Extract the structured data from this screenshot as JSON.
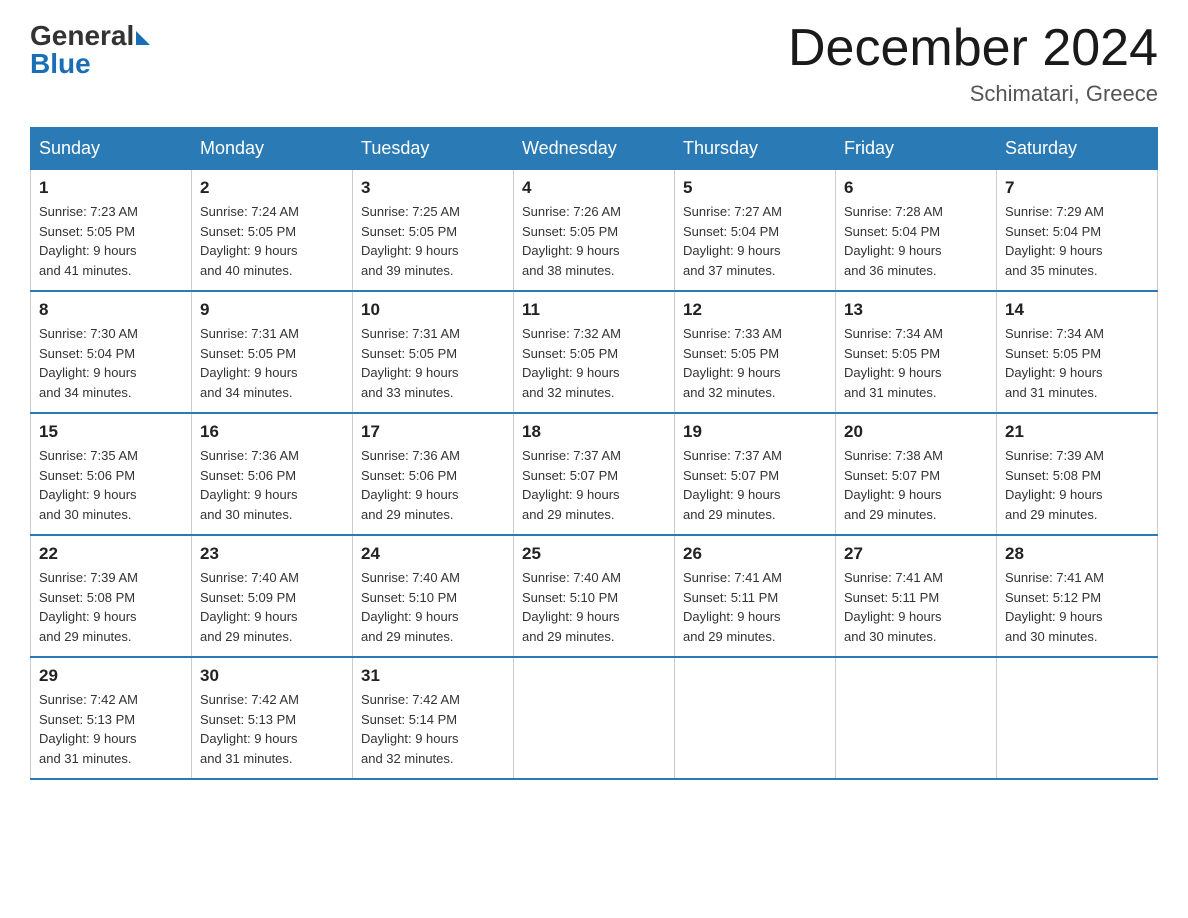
{
  "logo": {
    "general": "General",
    "blue": "Blue"
  },
  "title": "December 2024",
  "location": "Schimatari, Greece",
  "days_of_week": [
    "Sunday",
    "Monday",
    "Tuesday",
    "Wednesday",
    "Thursday",
    "Friday",
    "Saturday"
  ],
  "weeks": [
    [
      {
        "day": "1",
        "sunrise": "7:23 AM",
        "sunset": "5:05 PM",
        "daylight": "9 hours and 41 minutes."
      },
      {
        "day": "2",
        "sunrise": "7:24 AM",
        "sunset": "5:05 PM",
        "daylight": "9 hours and 40 minutes."
      },
      {
        "day": "3",
        "sunrise": "7:25 AM",
        "sunset": "5:05 PM",
        "daylight": "9 hours and 39 minutes."
      },
      {
        "day": "4",
        "sunrise": "7:26 AM",
        "sunset": "5:05 PM",
        "daylight": "9 hours and 38 minutes."
      },
      {
        "day": "5",
        "sunrise": "7:27 AM",
        "sunset": "5:04 PM",
        "daylight": "9 hours and 37 minutes."
      },
      {
        "day": "6",
        "sunrise": "7:28 AM",
        "sunset": "5:04 PM",
        "daylight": "9 hours and 36 minutes."
      },
      {
        "day": "7",
        "sunrise": "7:29 AM",
        "sunset": "5:04 PM",
        "daylight": "9 hours and 35 minutes."
      }
    ],
    [
      {
        "day": "8",
        "sunrise": "7:30 AM",
        "sunset": "5:04 PM",
        "daylight": "9 hours and 34 minutes."
      },
      {
        "day": "9",
        "sunrise": "7:31 AM",
        "sunset": "5:05 PM",
        "daylight": "9 hours and 34 minutes."
      },
      {
        "day": "10",
        "sunrise": "7:31 AM",
        "sunset": "5:05 PM",
        "daylight": "9 hours and 33 minutes."
      },
      {
        "day": "11",
        "sunrise": "7:32 AM",
        "sunset": "5:05 PM",
        "daylight": "9 hours and 32 minutes."
      },
      {
        "day": "12",
        "sunrise": "7:33 AM",
        "sunset": "5:05 PM",
        "daylight": "9 hours and 32 minutes."
      },
      {
        "day": "13",
        "sunrise": "7:34 AM",
        "sunset": "5:05 PM",
        "daylight": "9 hours and 31 minutes."
      },
      {
        "day": "14",
        "sunrise": "7:34 AM",
        "sunset": "5:05 PM",
        "daylight": "9 hours and 31 minutes."
      }
    ],
    [
      {
        "day": "15",
        "sunrise": "7:35 AM",
        "sunset": "5:06 PM",
        "daylight": "9 hours and 30 minutes."
      },
      {
        "day": "16",
        "sunrise": "7:36 AM",
        "sunset": "5:06 PM",
        "daylight": "9 hours and 30 minutes."
      },
      {
        "day": "17",
        "sunrise": "7:36 AM",
        "sunset": "5:06 PM",
        "daylight": "9 hours and 29 minutes."
      },
      {
        "day": "18",
        "sunrise": "7:37 AM",
        "sunset": "5:07 PM",
        "daylight": "9 hours and 29 minutes."
      },
      {
        "day": "19",
        "sunrise": "7:37 AM",
        "sunset": "5:07 PM",
        "daylight": "9 hours and 29 minutes."
      },
      {
        "day": "20",
        "sunrise": "7:38 AM",
        "sunset": "5:07 PM",
        "daylight": "9 hours and 29 minutes."
      },
      {
        "day": "21",
        "sunrise": "7:39 AM",
        "sunset": "5:08 PM",
        "daylight": "9 hours and 29 minutes."
      }
    ],
    [
      {
        "day": "22",
        "sunrise": "7:39 AM",
        "sunset": "5:08 PM",
        "daylight": "9 hours and 29 minutes."
      },
      {
        "day": "23",
        "sunrise": "7:40 AM",
        "sunset": "5:09 PM",
        "daylight": "9 hours and 29 minutes."
      },
      {
        "day": "24",
        "sunrise": "7:40 AM",
        "sunset": "5:10 PM",
        "daylight": "9 hours and 29 minutes."
      },
      {
        "day": "25",
        "sunrise": "7:40 AM",
        "sunset": "5:10 PM",
        "daylight": "9 hours and 29 minutes."
      },
      {
        "day": "26",
        "sunrise": "7:41 AM",
        "sunset": "5:11 PM",
        "daylight": "9 hours and 29 minutes."
      },
      {
        "day": "27",
        "sunrise": "7:41 AM",
        "sunset": "5:11 PM",
        "daylight": "9 hours and 30 minutes."
      },
      {
        "day": "28",
        "sunrise": "7:41 AM",
        "sunset": "5:12 PM",
        "daylight": "9 hours and 30 minutes."
      }
    ],
    [
      {
        "day": "29",
        "sunrise": "7:42 AM",
        "sunset": "5:13 PM",
        "daylight": "9 hours and 31 minutes."
      },
      {
        "day": "30",
        "sunrise": "7:42 AM",
        "sunset": "5:13 PM",
        "daylight": "9 hours and 31 minutes."
      },
      {
        "day": "31",
        "sunrise": "7:42 AM",
        "sunset": "5:14 PM",
        "daylight": "9 hours and 32 minutes."
      },
      null,
      null,
      null,
      null
    ]
  ],
  "labels": {
    "sunrise_prefix": "Sunrise: ",
    "sunset_prefix": "Sunset: ",
    "daylight_prefix": "Daylight: "
  }
}
